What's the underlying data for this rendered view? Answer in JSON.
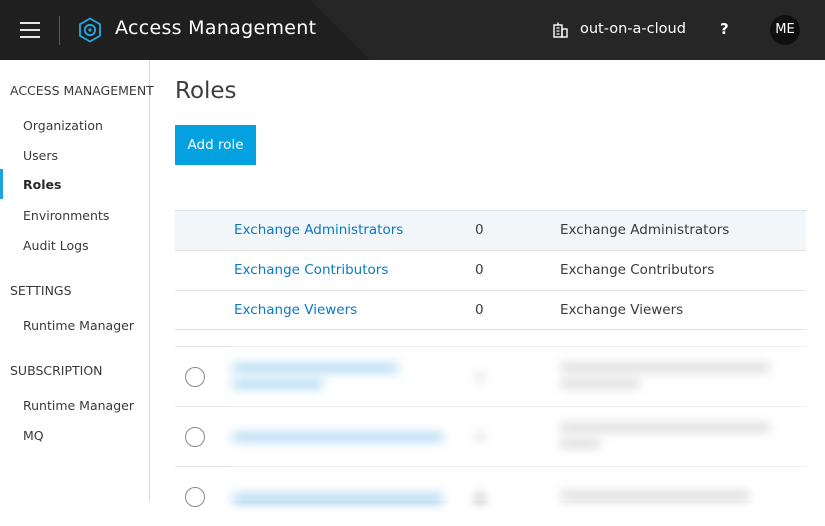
{
  "header": {
    "menu_icon": "hamburger-menu-icon",
    "logo_icon": "access-management-logo-icon",
    "title": "Access Management",
    "org_icon": "organization-building-icon",
    "org_name": "out-on-a-cloud",
    "help_label": "?",
    "avatar_initials": "ME"
  },
  "sidebar": {
    "sections": [
      {
        "heading": "ACCESS MANAGEMENT",
        "items": [
          "Organization",
          "Users",
          "Roles",
          "Environments",
          "Audit Logs"
        ]
      },
      {
        "heading": "SETTINGS",
        "items": [
          "Runtime Manager"
        ]
      },
      {
        "heading": "SUBSCRIPTION",
        "items": [
          "Runtime Manager",
          "MQ"
        ]
      }
    ],
    "active_item": "Roles"
  },
  "main": {
    "title": "Roles",
    "add_button_label": "Add role",
    "rows": [
      {
        "name": "Exchange Administrators",
        "count": "0",
        "description": "Exchange Administrators"
      },
      {
        "name": "Exchange Contributors",
        "count": "0",
        "description": "Exchange Contributors"
      },
      {
        "name": "Exchange Viewers",
        "count": "0",
        "description": "Exchange Viewers"
      }
    ]
  },
  "colors": {
    "topbar": "#262626",
    "accent_blue": "#03a1df",
    "link_blue": "#0a7ac1",
    "active_marker": "#1ea3e0"
  }
}
